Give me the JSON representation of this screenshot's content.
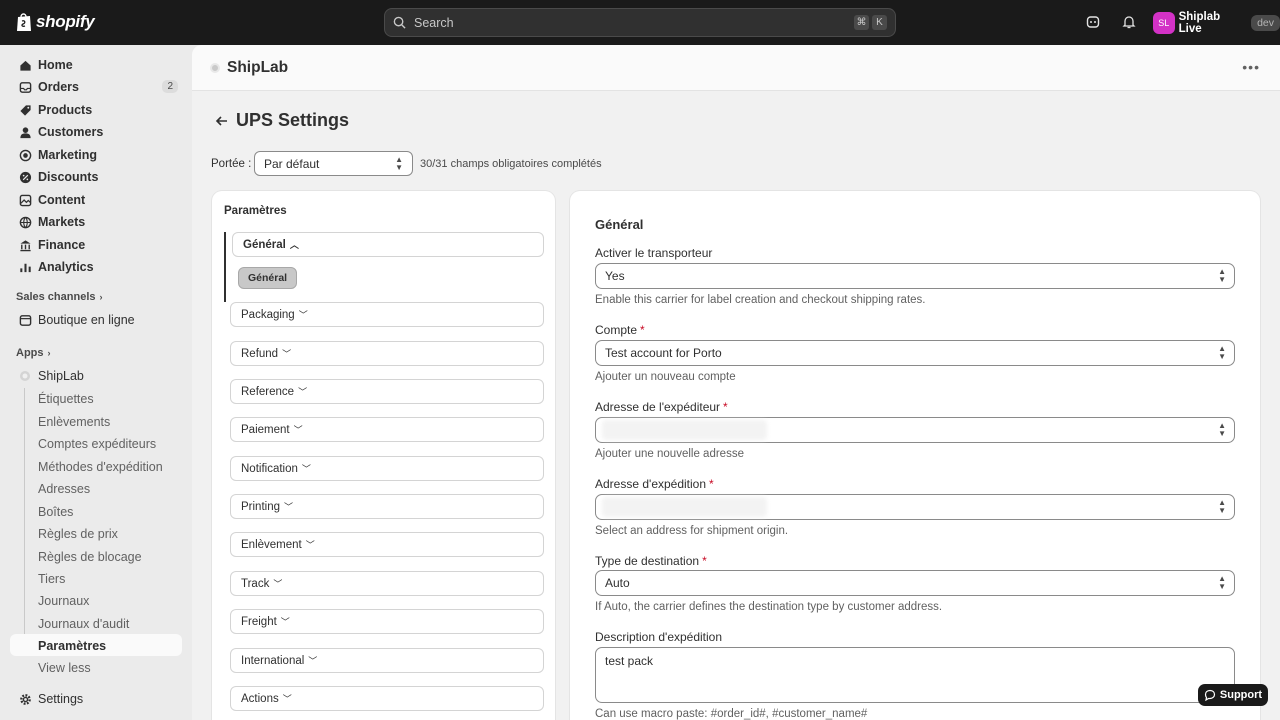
{
  "topbar": {
    "logo_text": "shopify",
    "search_placeholder": "Search",
    "kbd1": "⌘",
    "kbd2": "K",
    "store_initials": "SL",
    "store_name": "Shiplab Live",
    "store_badge": "dev"
  },
  "sidebar": {
    "items": [
      {
        "label": "Home",
        "icon": "home-icon"
      },
      {
        "label": "Orders",
        "icon": "orders-icon",
        "count": "2"
      },
      {
        "label": "Products",
        "icon": "products-icon"
      },
      {
        "label": "Customers",
        "icon": "customers-icon"
      },
      {
        "label": "Marketing",
        "icon": "marketing-icon"
      },
      {
        "label": "Discounts",
        "icon": "discounts-icon"
      },
      {
        "label": "Content",
        "icon": "content-icon"
      },
      {
        "label": "Markets",
        "icon": "markets-icon"
      },
      {
        "label": "Finance",
        "icon": "finance-icon"
      },
      {
        "label": "Analytics",
        "icon": "analytics-icon"
      }
    ],
    "sales_channels_label": "Sales channels",
    "online_store_label": "Boutique en ligne",
    "apps_label": "Apps",
    "app_name": "ShipLab",
    "app_subitems": [
      "Étiquettes",
      "Enlèvements",
      "Comptes expéditeurs",
      "Méthodes d'expédition",
      "Adresses",
      "Boîtes",
      "Règles de prix",
      "Règles de blocage",
      "Tiers",
      "Journaux",
      "Journaux d'audit",
      "Paramètres",
      "View less"
    ],
    "settings_label": "Settings"
  },
  "app_header": {
    "title": "ShipLab"
  },
  "page": {
    "title": "UPS Settings",
    "scope_label": "Portée :",
    "scope_value": "Par défaut",
    "completion_status": "30/31 champs obligatoires complétés"
  },
  "params_card": {
    "title": "Paramètres",
    "sections": [
      "Général",
      "Packaging",
      "Refund",
      "Reference",
      "Paiement",
      "Notification",
      "Printing",
      "Enlèvement",
      "Track",
      "Freight",
      "International",
      "Actions"
    ],
    "active_chip": "Général"
  },
  "general_card": {
    "title": "Général",
    "enable_label": "Activer le transporteur",
    "enable_value": "Yes",
    "enable_help": "Enable this carrier for label creation and checkout shipping rates.",
    "account_label": "Compte",
    "account_value": "Test account for Porto",
    "account_help": "Ajouter un nouveau compte",
    "sender_label": "Adresse de l'expéditeur",
    "sender_help": "Ajouter une nouvelle adresse",
    "shipping_label": "Adresse d'expédition",
    "shipping_help": "Select an address for shipment origin.",
    "dest_label": "Type de destination",
    "dest_value": "Auto",
    "dest_help": "If Auto, the carrier defines the destination type by customer address.",
    "desc_label": "Description d'expédition",
    "desc_value": "test pack",
    "desc_help": "Can use macro paste: #order_id#, #customer_name#"
  },
  "support_label": "Support"
}
